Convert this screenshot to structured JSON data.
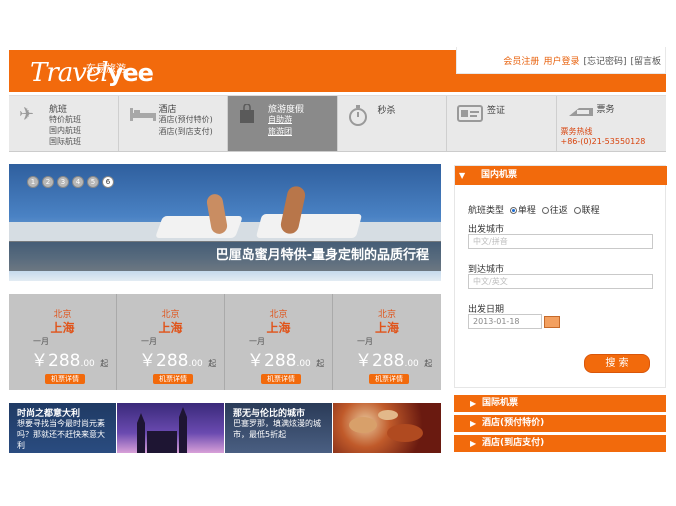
{
  "header": {
    "logo_text": "Travel",
    "logo_bold": "yee",
    "logo_cn": "东易旅游",
    "links": {
      "register": "会员注册",
      "login": "用户登录",
      "forgot": "[忘记密码]",
      "message": "[留言板"
    }
  },
  "nav": {
    "items": [
      {
        "title": "航班",
        "subs": [
          "特价航班",
          "国内航班",
          "国际航班"
        ]
      },
      {
        "title": "酒店",
        "subs": [
          "酒店(预付特价)",
          "酒店(到店支付)"
        ]
      },
      {
        "title": "旅游度假",
        "subs": [
          "自助游",
          "旅游团"
        ]
      },
      {
        "title": "秒杀",
        "subs": []
      },
      {
        "title": "签证",
        "subs": []
      },
      {
        "title": "票务",
        "subs": [
          "票务热线",
          "+86-(0)21-53550128"
        ]
      }
    ]
  },
  "banner": {
    "dots": [
      "1",
      "2",
      "3",
      "4",
      "5",
      "6"
    ],
    "caption": "巴厘岛蜜月特供-量身定制的品质行程"
  },
  "deals": [
    {
      "from": "北京",
      "to": "上海",
      "month": "一月",
      "currency": "￥",
      "price": "288",
      "decimal": ".00",
      "suffix": "起",
      "button": "机票详情"
    },
    {
      "from": "北京",
      "to": "上海",
      "month": "一月",
      "currency": "￥",
      "price": "288",
      "decimal": ".00",
      "suffix": "起",
      "button": "机票详情"
    },
    {
      "from": "北京",
      "to": "上海",
      "month": "一月",
      "currency": "￥",
      "price": "288",
      "decimal": ".00",
      "suffix": "起",
      "button": "机票详情"
    },
    {
      "from": "北京",
      "to": "上海",
      "month": "一月",
      "currency": "￥",
      "price": "288",
      "decimal": ".00",
      "suffix": "起",
      "button": "机票详情"
    }
  ],
  "tiles": [
    {
      "title": "时尚之都意大利",
      "desc": [
        "想要寻找当今最时尚元素",
        "吗？那就还不赶快来意大",
        "利"
      ]
    },
    {
      "title": "",
      "desc": []
    },
    {
      "title": "那无与伦比的城市",
      "desc": [
        "巴塞罗那，填满炫漫的城",
        "市，最低5折起"
      ]
    },
    {
      "title": "",
      "desc": []
    }
  ],
  "sidebar": {
    "header": "国内机票",
    "trip_type_label": "航班类型",
    "trip_types": [
      "单程",
      "往返",
      "联程"
    ],
    "from_label": "出发城市",
    "from_placeholder": "中文/拼音",
    "to_label": "到达城市",
    "to_placeholder": "中文/英文",
    "date_label": "出发日期",
    "date_value": "2013-01-18",
    "search_button": "搜 索",
    "tabs": [
      "国际机票",
      "酒店(预付特价)",
      "酒店(到店支付)"
    ]
  },
  "colors": {
    "brand": "#f26a0c",
    "nav_active": "#8a8a8a",
    "deal_bg": "#c4c4c4"
  }
}
